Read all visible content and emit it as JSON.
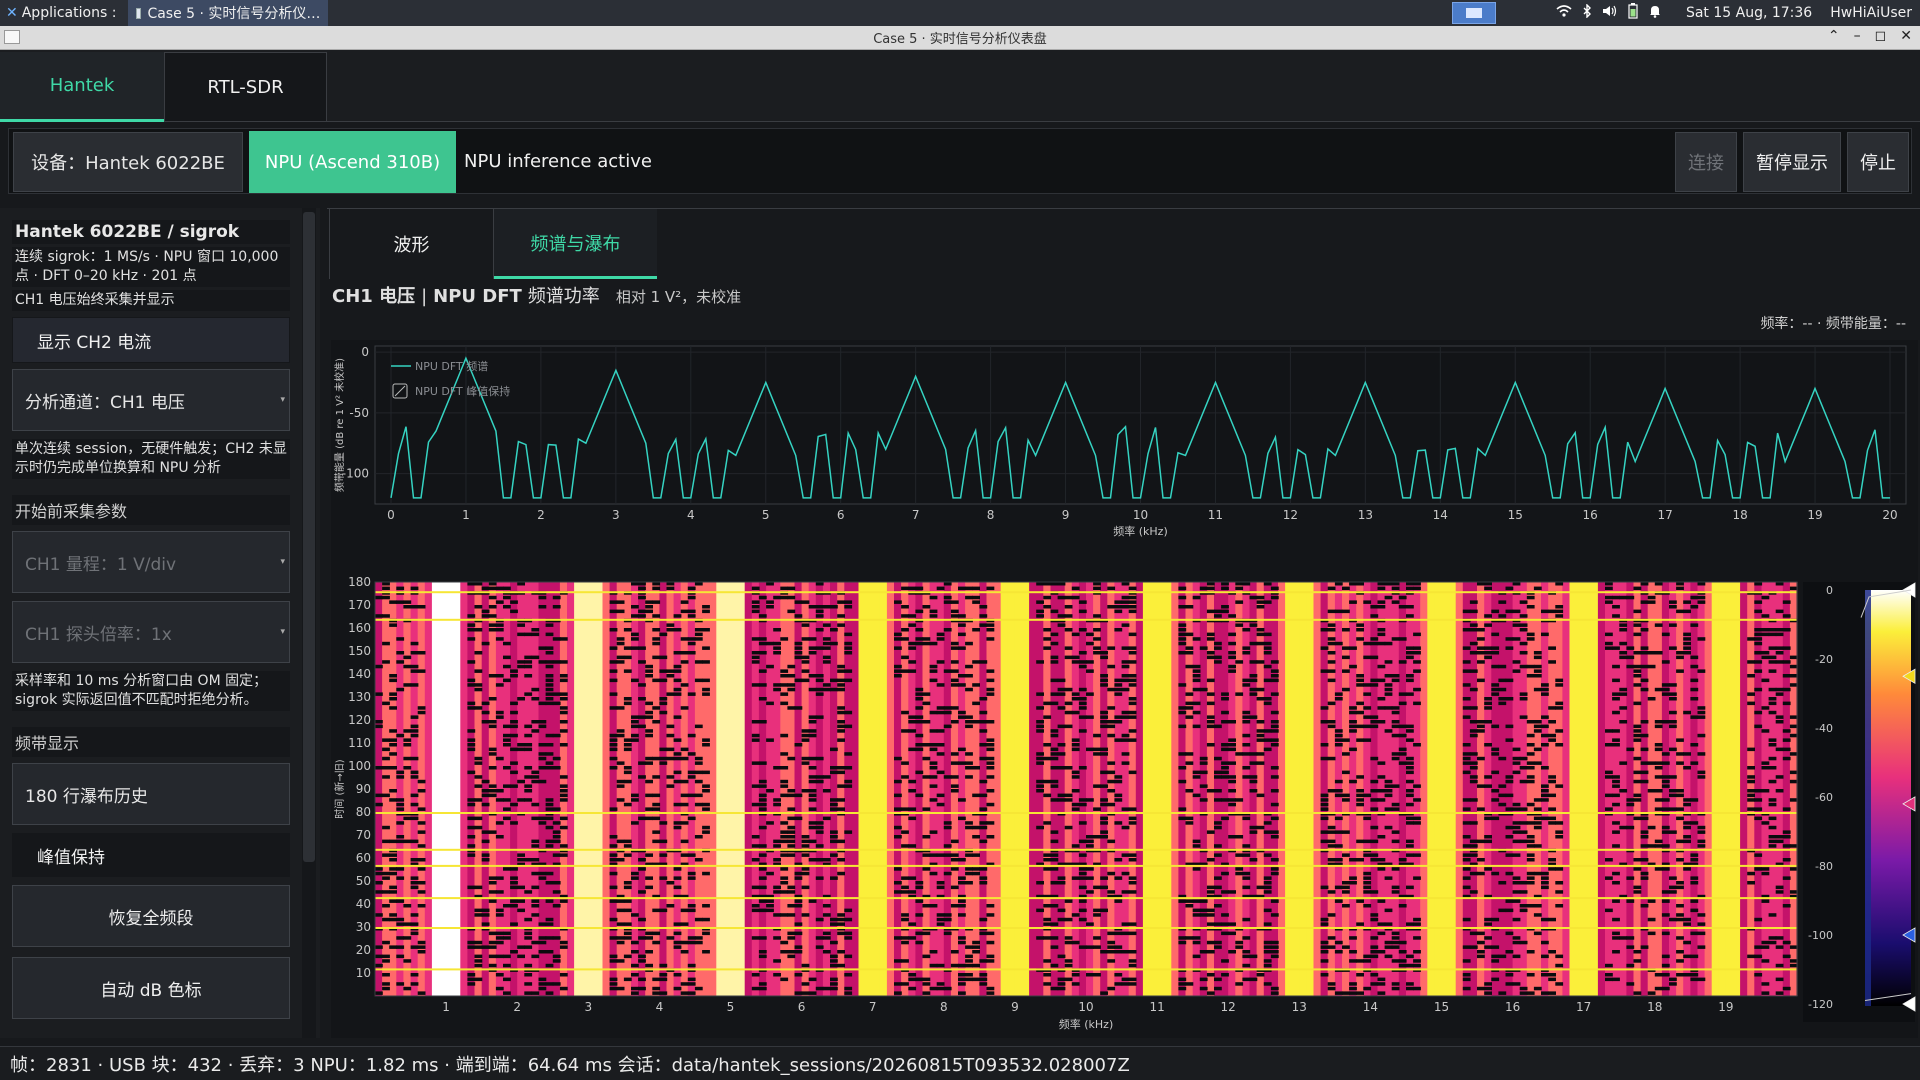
{
  "system_bar": {
    "applications": "Applications :",
    "task_title": "Case 5 · 实时信号分析仪…",
    "clock": "Sat 15 Aug, 17:36",
    "user": "HwHiAiUser",
    "icons": [
      "wifi-icon",
      "bluetooth-icon",
      "volume-icon",
      "battery-icon",
      "bell-icon"
    ]
  },
  "window": {
    "title": "Case 5 · 实时信号分析仪表盘",
    "controls": [
      "⌃",
      "–",
      "◻",
      "✕"
    ]
  },
  "device_tabs": [
    {
      "label": "Hantek",
      "active": true
    },
    {
      "label": "RTL-SDR",
      "active": false
    }
  ],
  "control_row": {
    "device": "设备：Hantek 6022BE",
    "npu_badge": "NPU (Ascend 310B)",
    "npu_status": "NPU inference active",
    "connect": "连接",
    "pause": "暂停显示",
    "stop": "停止"
  },
  "left_panel": {
    "title": "Hantek 6022BE / sigrok",
    "info1": "连续 sigrok：1 MS/s · NPU 窗口 10,000 点 · DFT 0–20 kHz · 201 点",
    "info2": "CH1 电压始终采集并显示",
    "show_ch2": "显示 CH2 电流",
    "analysis_channel": "分析通道：CH1 电压",
    "note1": "单次连续 session，无硬件触发；CH2 未显示时仍完成单位换算和 NPU 分析",
    "section_params": "开始前采集参数",
    "ch1_range": "CH1 量程：1 V/div",
    "ch1_probe": "CH1 探头倍率：1x",
    "note2": "采样率和 10 ms 分析窗口由 OM 固定；sigrok 实际返回值不匹配时拒绝分析。",
    "section_band": "频带显示",
    "waterfall_rows": "180 行瀑布历史",
    "peak_hold": "峰值保持",
    "restore": "恢复全频段",
    "auto_db": "自动 dB 色标"
  },
  "view_tabs": [
    {
      "label": "波形",
      "active": false
    },
    {
      "label": "频谱与瀑布",
      "active": true
    }
  ],
  "spectrum_heading": {
    "ch": "CH1 电压",
    "sep": "|",
    "npu": "NPU DFT",
    "kind": "频谱功率",
    "ref": "相对 1 V²，未校准"
  },
  "cursor_readout": "频率：-- · 频带能量：--",
  "status_bar": "帧：2831 · USB 块：432 · 丢弃：3 NPU：1.82 ms · 端到端：64.64 ms 会话：data/hantek_sessions/20260815T093532.028007Z",
  "colors": {
    "accent": "#3fd9a7",
    "npu_green": "#3ec590",
    "trace": "#35d3c2"
  },
  "chart_data": [
    {
      "type": "line",
      "ylabel": "频带能量 (dB re 1 V² 未校准)",
      "xlabel": "频率 (kHz)",
      "xlim": [
        0,
        20
      ],
      "ylim": [
        -125,
        5
      ],
      "xticks": [
        0,
        1,
        2,
        3,
        4,
        5,
        6,
        7,
        8,
        9,
        10,
        11,
        12,
        13,
        14,
        15,
        16,
        17,
        18,
        19,
        20
      ],
      "yticks": [
        0,
        -50,
        -100
      ],
      "grid": true,
      "legend": {
        "placement": "top-left",
        "entries": [
          "NPU DFT 频谱",
          "NPU DFT 峰值保持"
        ]
      },
      "peaks_khz": [
        1,
        3,
        5,
        7,
        9,
        11,
        13,
        15,
        17,
        19
      ],
      "peak_db": [
        -5,
        -15,
        -25,
        -20,
        -25,
        -25,
        -25,
        -25,
        -30,
        -30
      ],
      "noise_floor_db": -120,
      "series": [
        {
          "name": "NPU DFT 频谱"
        }
      ]
    },
    {
      "type": "heatmap",
      "xlabel": "频率 (kHz)",
      "ylabel": "时间 (新→旧)",
      "xlim": [
        0,
        20
      ],
      "xticks": [
        1,
        2,
        3,
        4,
        5,
        6,
        7,
        8,
        9,
        10,
        11,
        12,
        13,
        14,
        15,
        16,
        17,
        18,
        19
      ],
      "ylim": [
        0,
        180
      ],
      "yticks": [
        10,
        20,
        30,
        40,
        50,
        60,
        70,
        80,
        90,
        100,
        110,
        120,
        130,
        140,
        150,
        160,
        170,
        180
      ],
      "colorbar": {
        "range_db": [
          -120,
          0
        ],
        "ticks": [
          0,
          -20,
          -40,
          -60,
          -80,
          -100,
          -120
        ]
      },
      "bright_columns_khz": [
        1,
        3,
        5,
        7,
        9,
        11,
        13,
        15,
        17,
        19
      ]
    }
  ]
}
